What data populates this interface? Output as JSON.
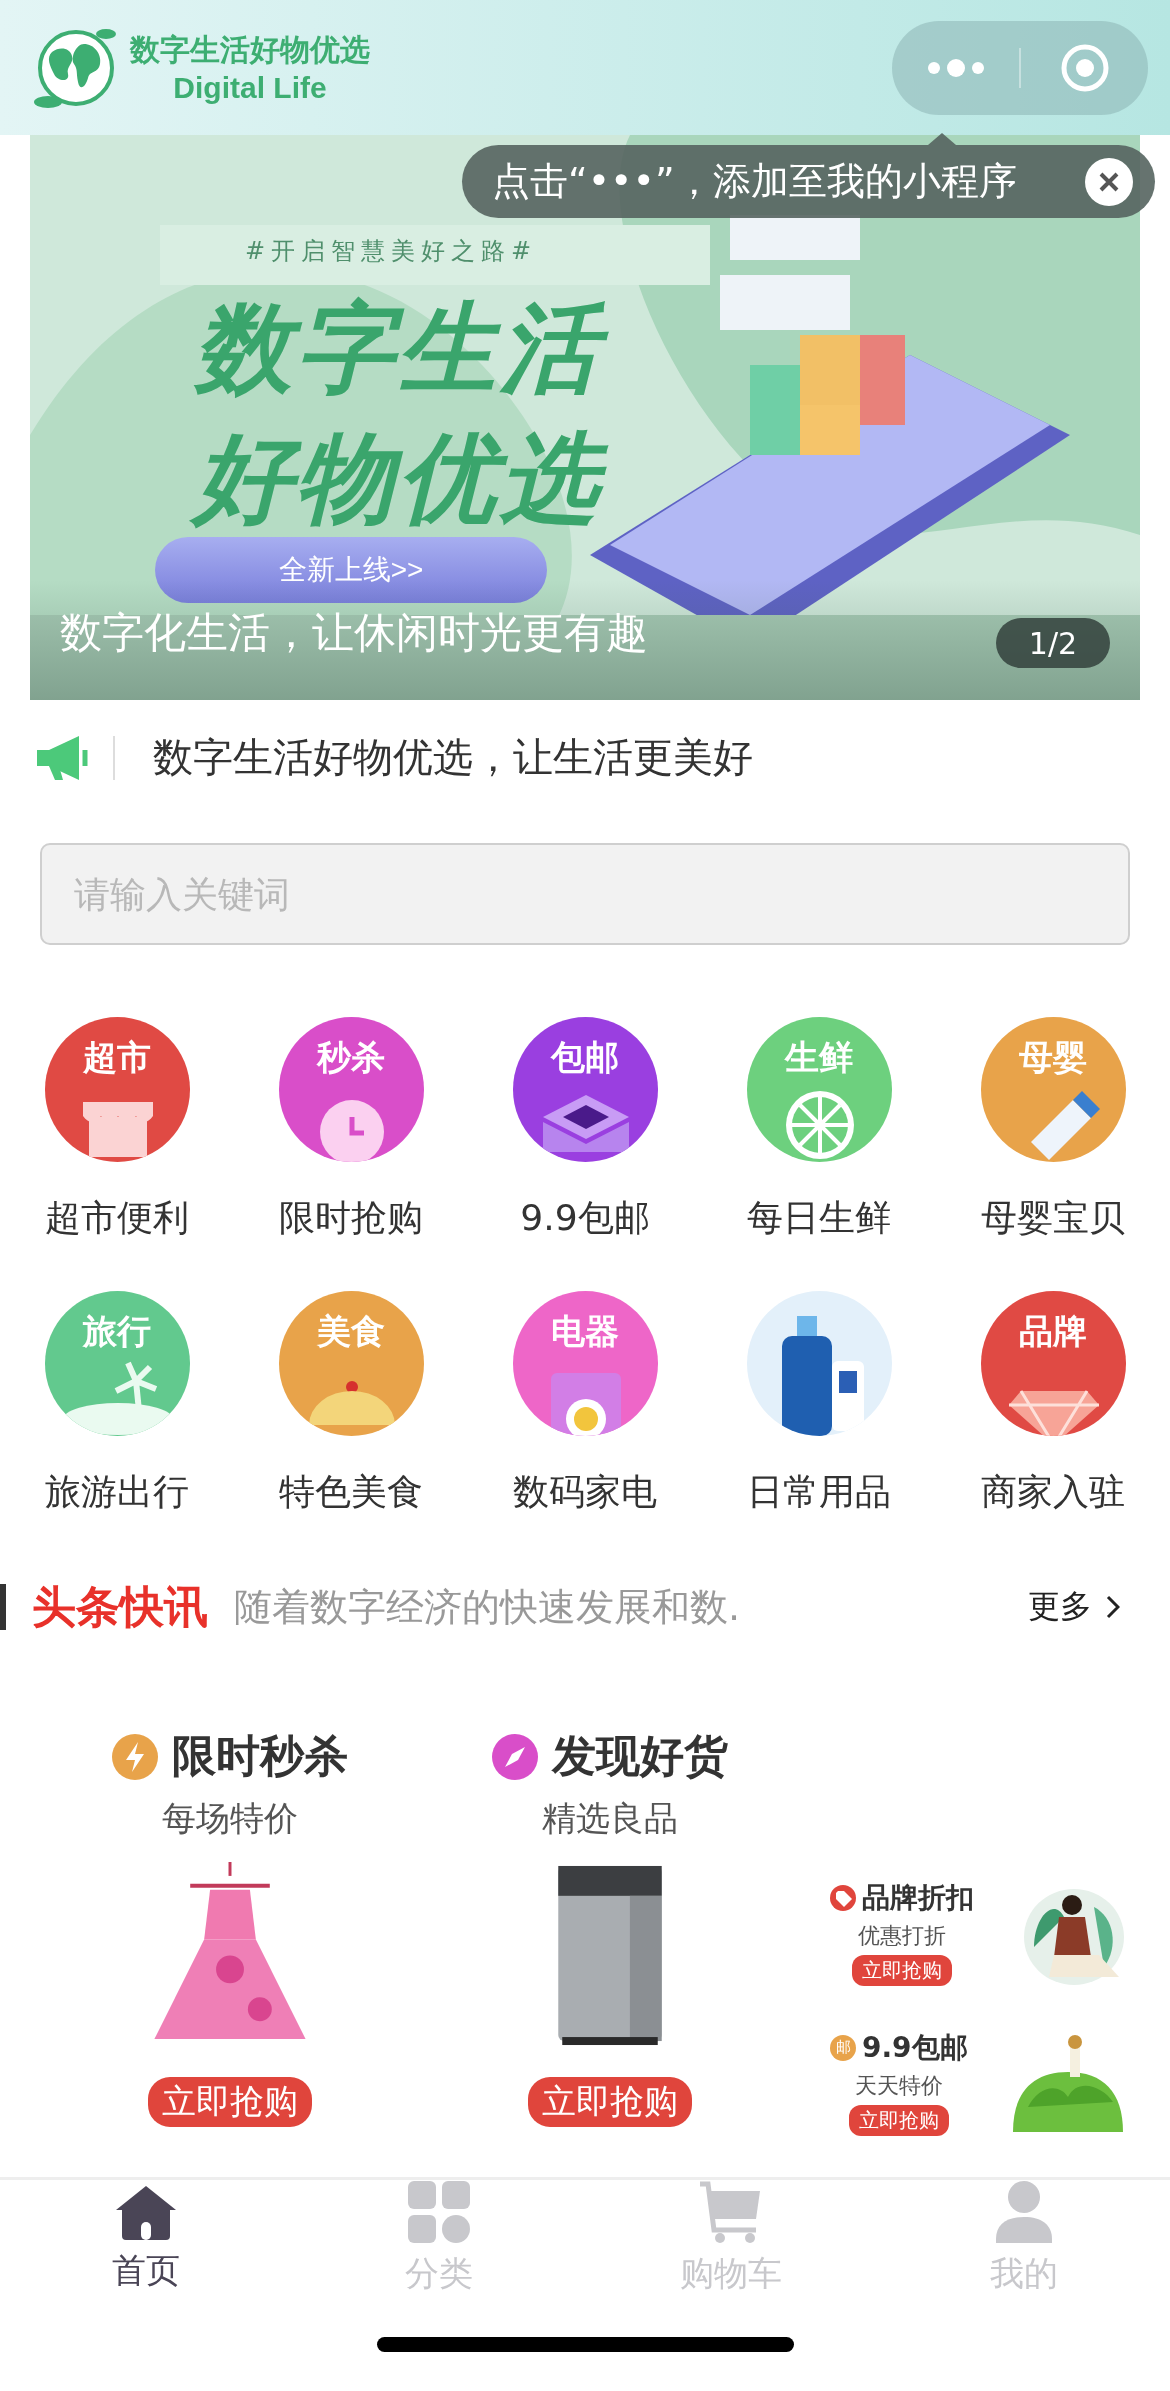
{
  "header": {
    "logo_title": "数字生活好物优选",
    "logo_subtitle": "Digital Life"
  },
  "tooltip": {
    "text": "点击“•••”，添加至我的小程序"
  },
  "banner": {
    "hashtag": "#开启智慧美好之路#",
    "headline": [
      "数字生活",
      "好物优选"
    ],
    "button": "全新上线>>",
    "caption": "数字化生活，让休闲时光更有趣",
    "page": "1/2"
  },
  "notice": {
    "text": "数字生活好物优选，让生活更美好"
  },
  "search": {
    "placeholder": "请输入关键词"
  },
  "categories": [
    {
      "label": "超市便利",
      "badge": "超市",
      "color": "#e04a44",
      "kind": "awning"
    },
    {
      "label": "限时抢购",
      "badge": "秒杀",
      "color": "#d94ec9",
      "kind": "clock"
    },
    {
      "label": "9.9包邮",
      "badge": "包邮",
      "color": "#9a3fe0",
      "kind": "box"
    },
    {
      "label": "每日生鲜",
      "badge": "生鲜",
      "color": "#6dd07e",
      "kind": "lime"
    },
    {
      "label": "母婴宝贝",
      "badge": "母婴",
      "color": "#e8a34a",
      "kind": "bottle"
    },
    {
      "label": "旅游出行",
      "badge": "旅行",
      "color": "#62c98e",
      "kind": "palm"
    },
    {
      "label": "特色美食",
      "badge": "美食",
      "color": "#e8a34a",
      "kind": "cloche"
    },
    {
      "label": "数码家电",
      "badge": "电器",
      "color": "#ee66c8",
      "kind": "washer"
    },
    {
      "label": "日常用品",
      "color": "#e3f0fa",
      "kind": "bottles"
    },
    {
      "label": "商家入驻",
      "badge": "品牌",
      "color": "#e04a44",
      "kind": "gem"
    }
  ],
  "news": {
    "title": "头条快讯",
    "text": "随着数字经济的快速发展和数.",
    "more": "更多"
  },
  "promos": [
    {
      "title": "限时秒杀",
      "subtitle": "每场特价",
      "button": "立即抢购",
      "kind": "flash"
    },
    {
      "title": "发现好货",
      "subtitle": "精选良品",
      "button": "立即抢购",
      "kind": "compass"
    }
  ],
  "side_promos": [
    {
      "title": "品牌折扣",
      "subtitle": "优惠打折",
      "button": "立即抢购",
      "kind": "tag"
    },
    {
      "title": "9.9包邮",
      "subtitle": "天天特价",
      "button": "立即抢购",
      "kind": "mail",
      "icon_text": "邮"
    }
  ],
  "tabs": [
    {
      "label": "首页",
      "selected": true,
      "kind": "home"
    },
    {
      "label": "分类",
      "selected": false,
      "kind": "grid"
    },
    {
      "label": "购物车",
      "selected": false,
      "kind": "cart"
    },
    {
      "label": "我的",
      "selected": false,
      "kind": "user"
    }
  ]
}
